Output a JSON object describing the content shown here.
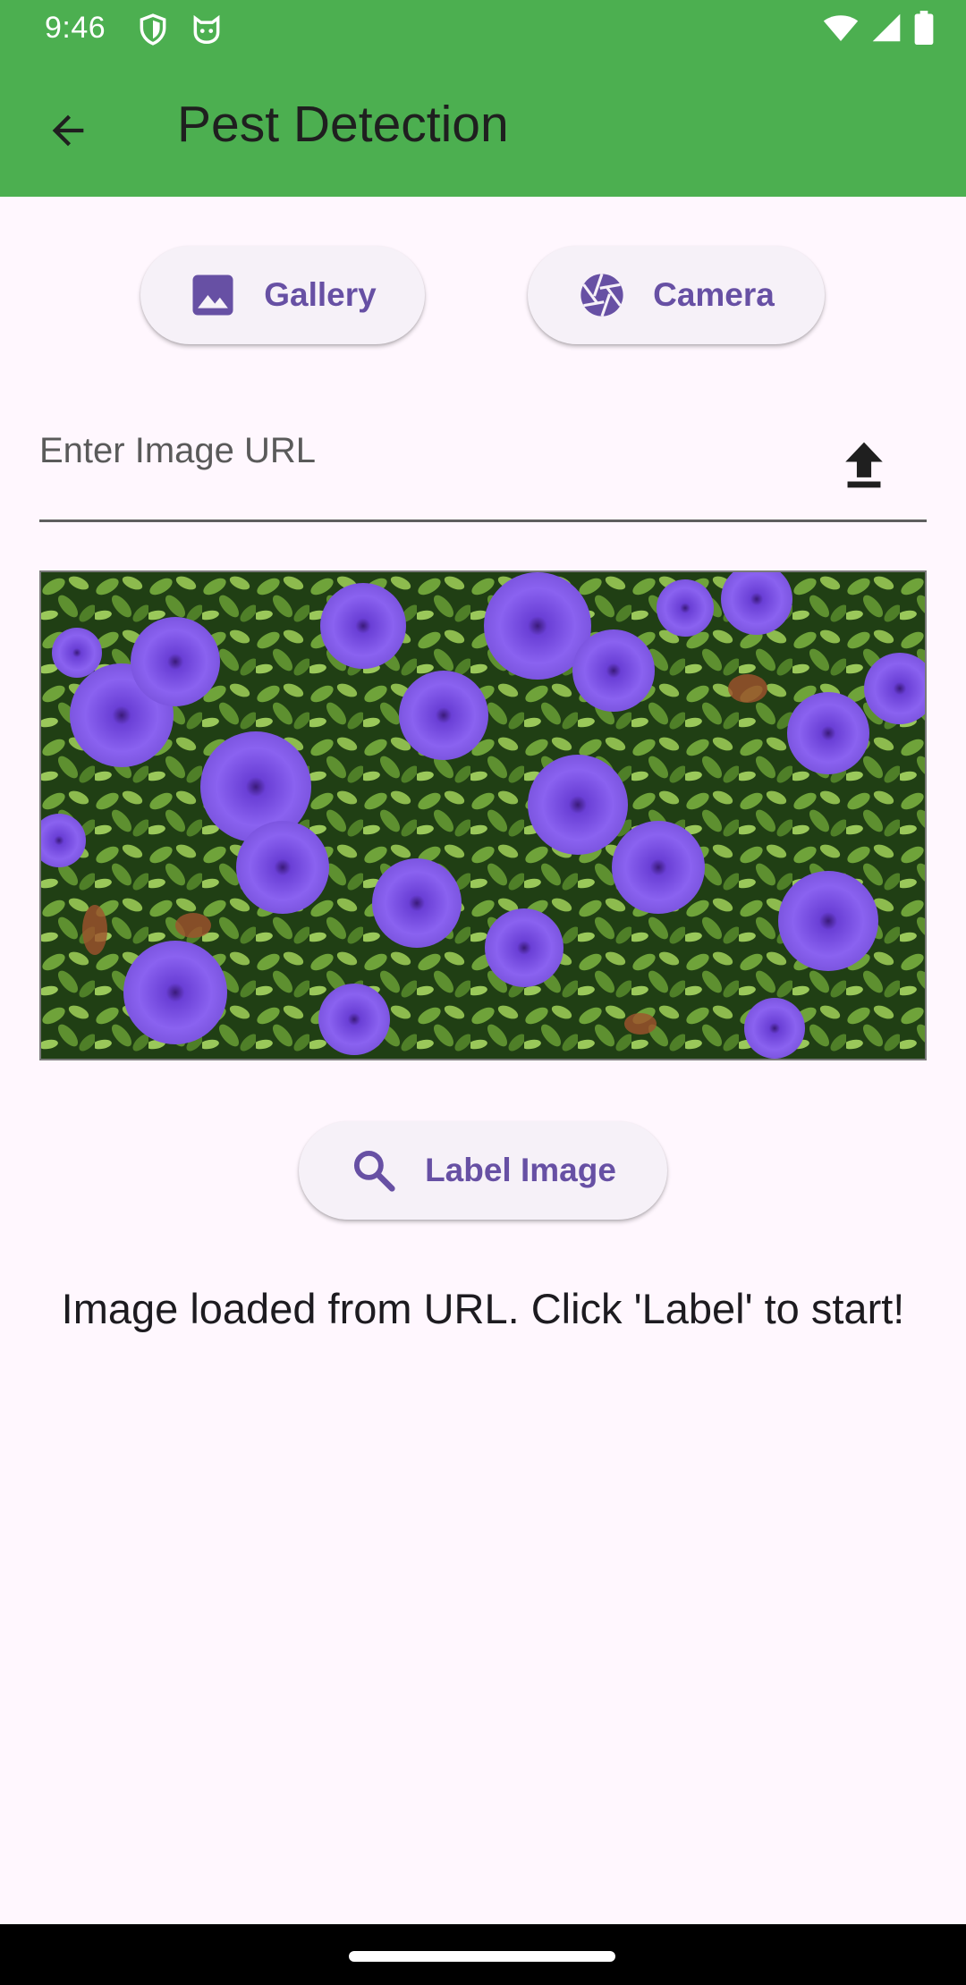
{
  "status_bar": {
    "time": "9:46",
    "left_icons": [
      "shield-icon",
      "cat-face-icon"
    ],
    "right_icons": [
      "wifi-icon",
      "signal-icon",
      "battery-icon"
    ]
  },
  "app_bar": {
    "title": "Pest Detection",
    "back_icon": "arrow-back-icon",
    "color": "#4CAF50"
  },
  "source_buttons": {
    "gallery_label": "Gallery",
    "gallery_icon": "image-icon",
    "camera_label": "Camera",
    "camera_icon": "camera-shutter-icon"
  },
  "url_input": {
    "placeholder": "Enter Image URL",
    "value": "",
    "action_icon": "upload-icon"
  },
  "preview": {
    "content": "purple-petunia-flowers-photo"
  },
  "label_button": {
    "label": "Label Image",
    "icon": "search-icon"
  },
  "status_message": "Image loaded from URL. Click 'Label' to start!",
  "colors": {
    "accent": "#6750A4",
    "background": "#FFF7FE",
    "button_bg": "#F6F1F8"
  }
}
